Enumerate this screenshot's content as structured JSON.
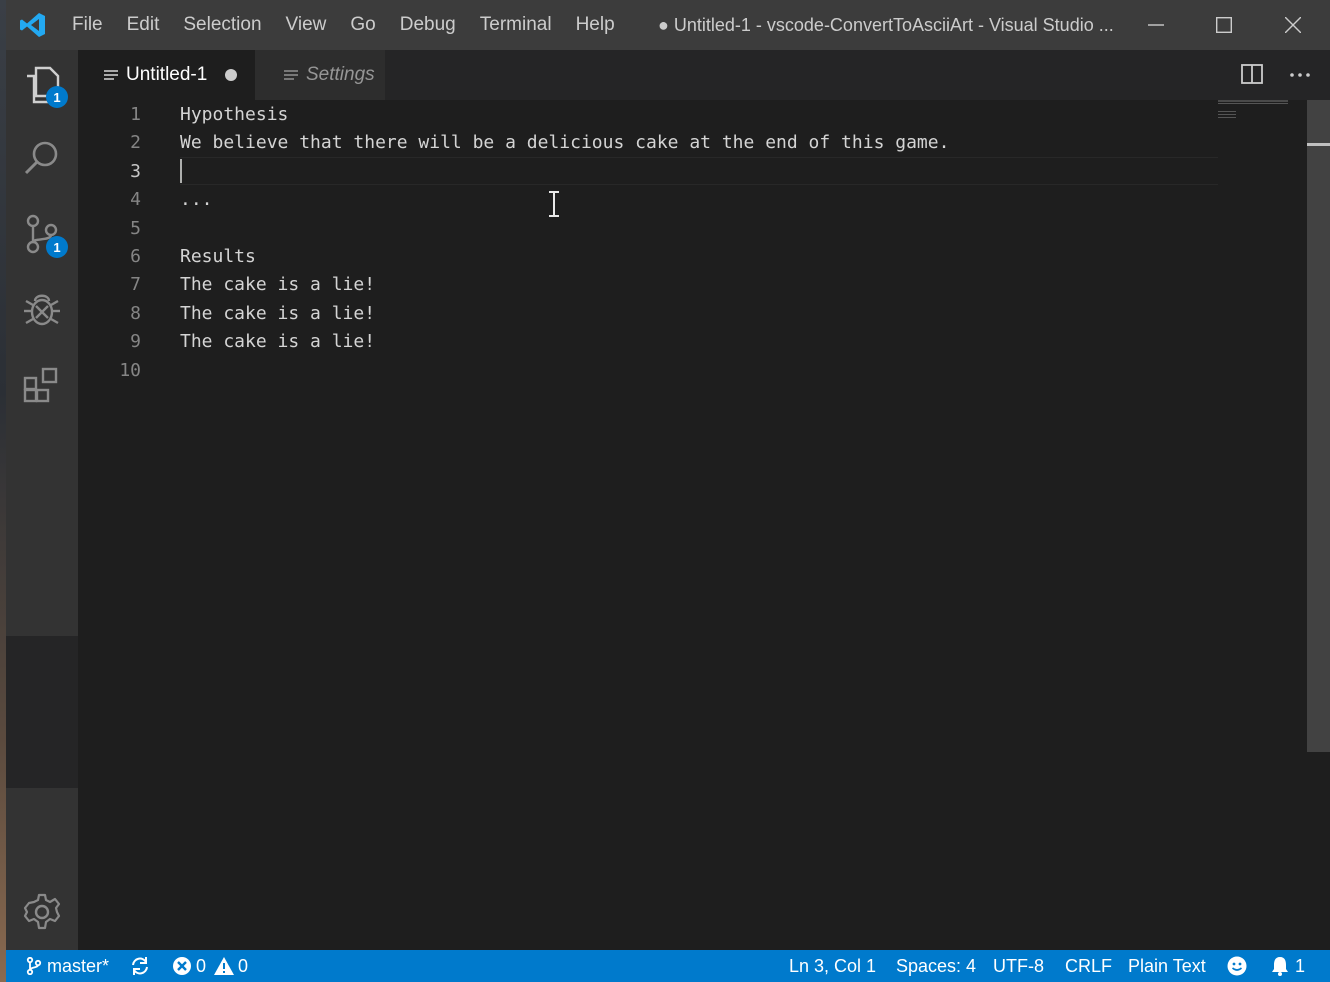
{
  "titlebar": {
    "menu": [
      "File",
      "Edit",
      "Selection",
      "View",
      "Go",
      "Debug",
      "Terminal",
      "Help"
    ],
    "title": "● Untitled-1 - vscode-ConvertToAsciiArt - Visual Studio ...",
    "controls": [
      "minimize-icon",
      "maximize-icon",
      "close-icon"
    ]
  },
  "activitybar": {
    "items": [
      {
        "name": "explorer-icon",
        "badge": "1"
      },
      {
        "name": "search-icon",
        "badge": ""
      },
      {
        "name": "source-control-icon",
        "badge": "1"
      },
      {
        "name": "debug-icon",
        "badge": ""
      },
      {
        "name": "extensions-icon",
        "badge": ""
      }
    ],
    "bottom": "gear-icon"
  },
  "tabs": [
    {
      "label": "Untitled-1",
      "active": true,
      "dirty": true
    },
    {
      "label": "Settings",
      "active": false
    }
  ],
  "editor": {
    "lines": [
      {
        "num": "1",
        "text": "Hypothesis"
      },
      {
        "num": "2",
        "text": "We believe that there will be a delicious cake at the end of this game."
      },
      {
        "num": "3",
        "text": ""
      },
      {
        "num": "4",
        "text": "..."
      },
      {
        "num": "5",
        "text": ""
      },
      {
        "num": "6",
        "text": "Results"
      },
      {
        "num": "7",
        "text": "The cake is a lie!"
      },
      {
        "num": "8",
        "text": "The cake is a lie!"
      },
      {
        "num": "9",
        "text": "The cake is a lie!"
      },
      {
        "num": "10",
        "text": ""
      }
    ],
    "current_line": 3
  },
  "statusbar": {
    "branch": "master*",
    "errors": "0",
    "warnings": "0",
    "position": "Ln 3, Col 1",
    "spaces": "Spaces: 4",
    "encoding": "UTF-8",
    "eol": "CRLF",
    "language": "Plain Text",
    "notifications": "1"
  },
  "colors": {
    "accent": "#007acc",
    "titlebar": "#3c3c3c",
    "activitybar": "#333333",
    "editor_bg": "#1e1e1e"
  }
}
